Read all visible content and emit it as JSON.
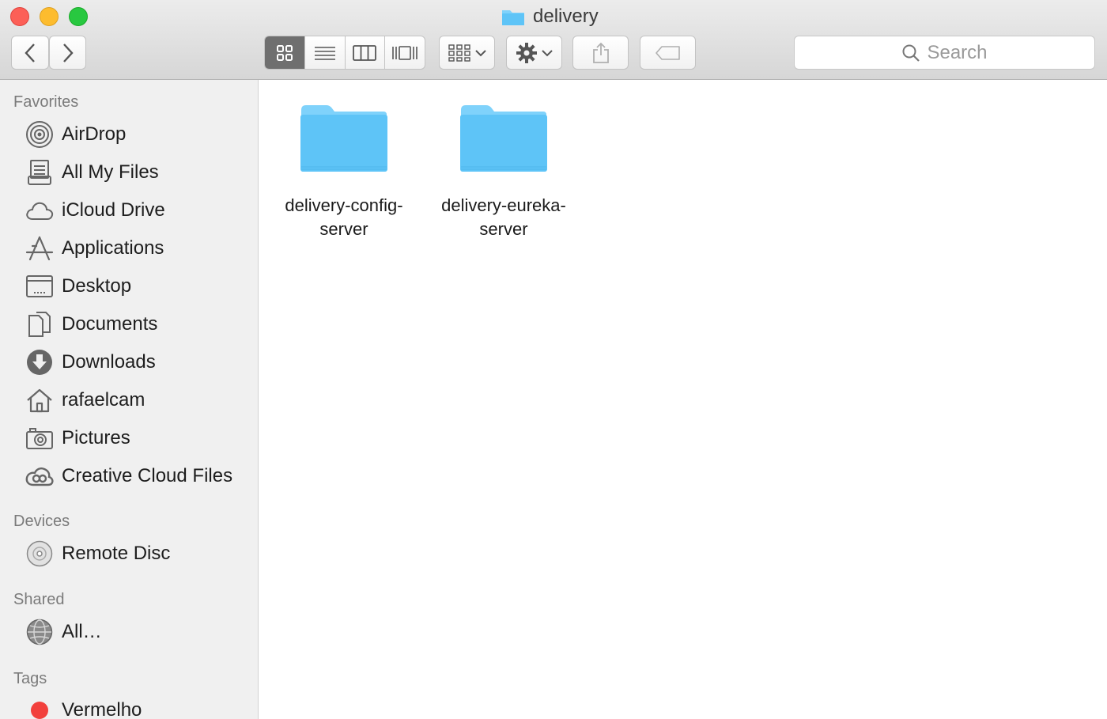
{
  "window": {
    "title": "delivery"
  },
  "toolbar": {
    "back_icon": "chevron-left-icon",
    "forward_icon": "chevron-right-icon",
    "view_modes": [
      "icon-view",
      "list-view",
      "column-view",
      "cover-flow-view"
    ],
    "active_view": "icon-view",
    "search_placeholder": "Search"
  },
  "sidebar": {
    "favorites_title": "Favorites",
    "favorites": [
      {
        "label": "AirDrop",
        "icon": "airdrop-icon"
      },
      {
        "label": "All My Files",
        "icon": "all-files-icon"
      },
      {
        "label": "iCloud Drive",
        "icon": "cloud-icon"
      },
      {
        "label": "Applications",
        "icon": "applications-icon"
      },
      {
        "label": "Desktop",
        "icon": "desktop-icon"
      },
      {
        "label": "Documents",
        "icon": "documents-icon"
      },
      {
        "label": "Downloads",
        "icon": "downloads-icon"
      },
      {
        "label": "rafaelcam",
        "icon": "home-icon"
      },
      {
        "label": "Pictures",
        "icon": "camera-icon"
      },
      {
        "label": "Creative Cloud Files",
        "icon": "creative-cloud-icon"
      }
    ],
    "devices_title": "Devices",
    "devices": [
      {
        "label": "Remote Disc",
        "icon": "disc-icon"
      }
    ],
    "shared_title": "Shared",
    "shared": [
      {
        "label": "All…",
        "icon": "network-globe-icon"
      }
    ],
    "tags_title": "Tags",
    "tags": [
      {
        "label": "Vermelho",
        "color": "#f2403c"
      }
    ]
  },
  "content": {
    "files": [
      {
        "line1": "delivery-config-",
        "line2": "server",
        "kind": "folder"
      },
      {
        "line1": "delivery-eureka-",
        "line2": "server",
        "kind": "folder"
      }
    ]
  },
  "colors": {
    "folder_front": "#5ec4f7",
    "folder_back": "#7fd2fb",
    "traffic_close": "#fc5f57",
    "traffic_minimize": "#fdbc2e",
    "traffic_maximize": "#28c840"
  }
}
